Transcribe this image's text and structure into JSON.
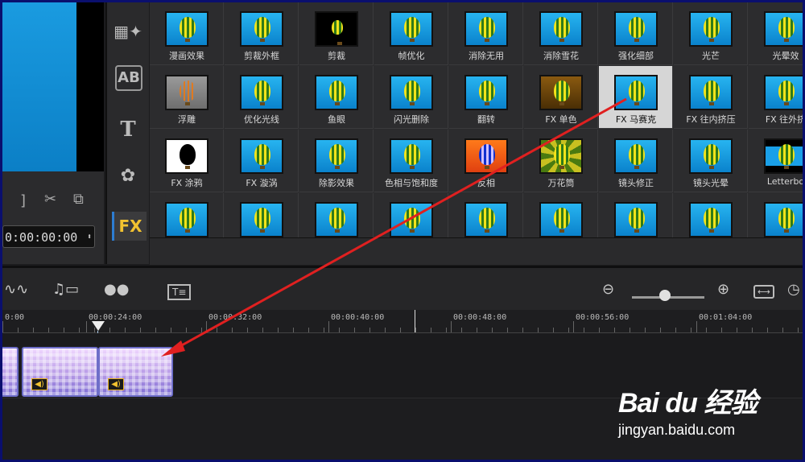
{
  "preview": {
    "timecode": "0:00:00:00"
  },
  "categories": [
    {
      "name": "instant-project-icon",
      "label": ""
    },
    {
      "name": "title-icon",
      "label": "AB"
    },
    {
      "name": "text-icon",
      "label": "T"
    },
    {
      "name": "graphics-icon",
      "label": ""
    },
    {
      "name": "fx-icon",
      "label": "FX"
    }
  ],
  "library": {
    "rows": [
      [
        "漫画效果",
        "剪裁外框",
        "剪裁",
        "帧优化",
        "消除无用",
        "消除雪花",
        "强化细部",
        "光芒",
        "光晕效"
      ],
      [
        "浮雕",
        "优化光线",
        "鱼眼",
        "闪光删除",
        "翻转",
        "FX 单色",
        "FX 马赛克",
        "FX 往内挤压",
        "FX 往外挤"
      ],
      [
        "FX 涂鸦",
        "FX 漩涡",
        "除影效果",
        "色相与饱和度",
        "反相",
        "万花筒",
        "镜头修正",
        "镜头光晕",
        "Letterbo"
      ],
      [
        "",
        "",
        "",
        "",
        "",
        "",
        "",
        "",
        ""
      ]
    ],
    "selected": "FX 马赛克"
  },
  "ruler": {
    "labels": [
      "0:00",
      "00:00:24:00",
      "00:00:32:00",
      "00:00:40:00",
      "00:00:48:00",
      "00:00:56:00",
      "00:01:04:00"
    ]
  },
  "watermark": {
    "logo": "Bai du 经验",
    "url": "jingyan.baidu.com"
  },
  "colors": {
    "accent": "#2d7dd2",
    "fx_yellow": "#f2c230",
    "arrow_red": "#e02020",
    "frame_border": "#0a0f6e"
  }
}
